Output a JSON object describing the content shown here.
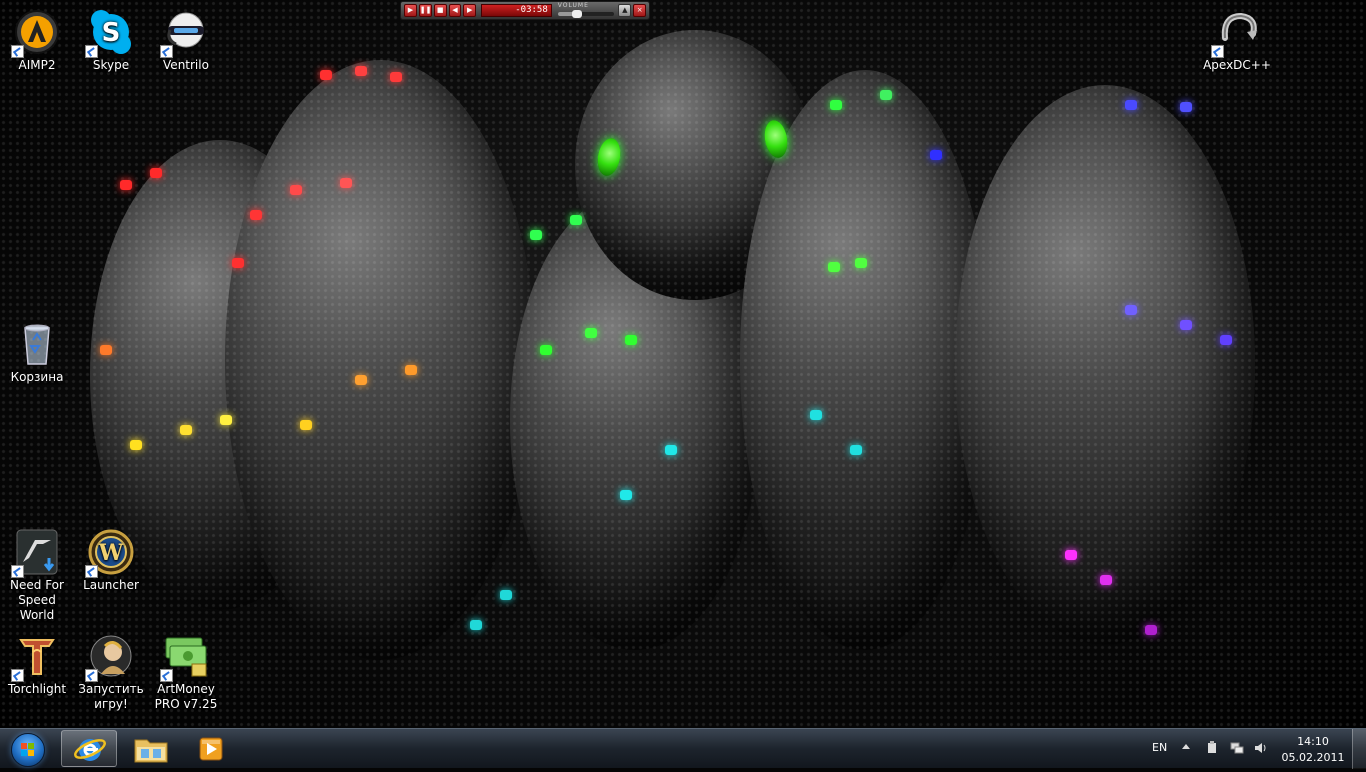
{
  "desktop": {
    "icons": {
      "aimp": {
        "label": "AIMP2"
      },
      "skype": {
        "label": "Skype"
      },
      "ventrilo": {
        "label": "Ventrilo"
      },
      "apexdc": {
        "label": "ApexDC++"
      },
      "recycle": {
        "label": "Корзина"
      },
      "nfs": {
        "label": "Need For Speed World"
      },
      "wow": {
        "label": "Launcher"
      },
      "torchlight": {
        "label": "Torchlight"
      },
      "run_game": {
        "label": "Запустить игру!"
      },
      "artmoney": {
        "label": "ArtMoney PRO v7.25"
      }
    }
  },
  "player": {
    "time": "-03:58",
    "volume_label": "VOLUME",
    "volume_level": 0.35,
    "buttons": [
      "play-icon",
      "pause-icon",
      "stop-icon",
      "prev-icon",
      "next-icon"
    ]
  },
  "taskbar": {
    "pinned": [
      "internet-explorer",
      "windows-explorer",
      "media-player"
    ],
    "active": "internet-explorer",
    "language": "EN",
    "time": "14:10",
    "date": "05.02.2011"
  },
  "colors": {
    "taskbar": "#1d242d",
    "start_orb": "#1f6dc2",
    "snake_eye": "#35e010"
  }
}
